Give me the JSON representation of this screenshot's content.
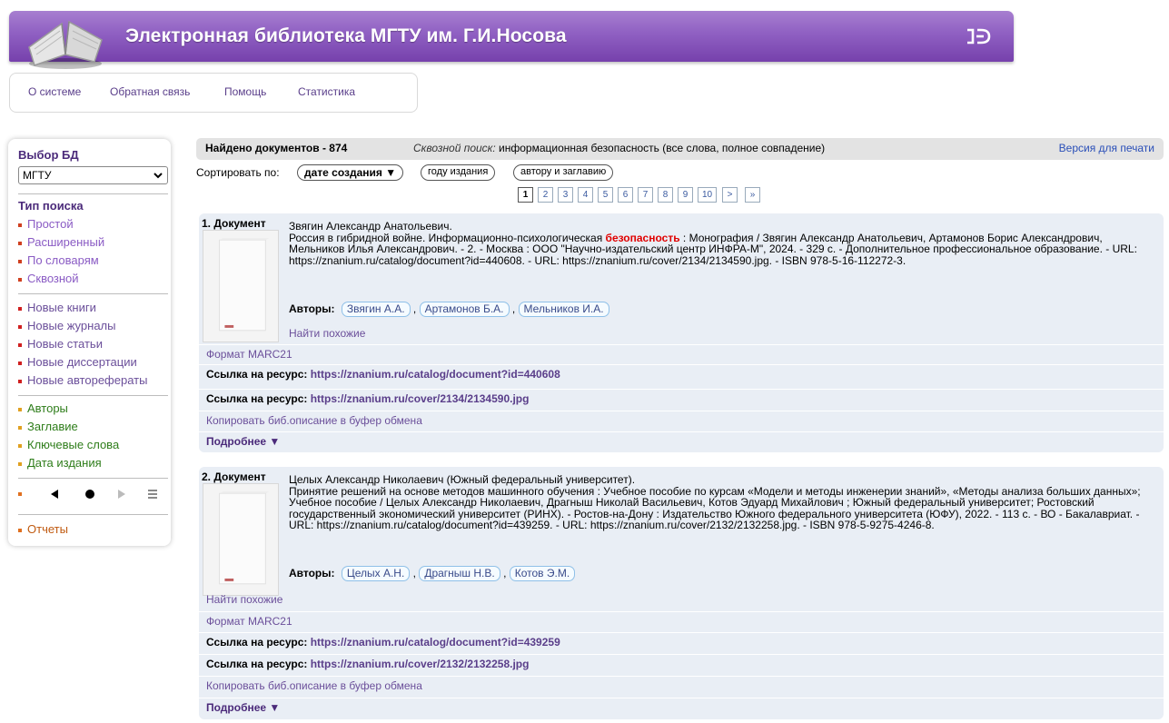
{
  "header": {
    "title": "Электронная библиотека МГТУ им. Г.И.Носова",
    "logo_icon": "open-book-icon",
    "corner_icon": "ib-logo-icon"
  },
  "topnav": {
    "items": [
      "О системе",
      "Обратная связь",
      "Помощь",
      "Статистика"
    ]
  },
  "sidebar": {
    "db_label": "Выбор БД",
    "db_value": "МГТУ",
    "search_type_label": "Тип поиска",
    "search_types": [
      "Простой",
      "Расширенный",
      "По словарям",
      "Сквозной"
    ],
    "news": [
      "Новые книги",
      "Новые журналы",
      "Новые статьи",
      "Новые диссертации",
      "Новые авторефераты"
    ],
    "browse": [
      "Авторы",
      "Заглавие",
      "Ключевые слова",
      "Дата издания"
    ],
    "reports": "Отчеты",
    "colors": {
      "search_bullet": "#8a5bc4",
      "news_bullet": "#d02020",
      "browse_bullet": "#5aa02c",
      "reports_bullet": "#e07020"
    }
  },
  "results": {
    "found": "Найдено документов - 874",
    "through_label": "Сквозной поиск:",
    "through_query": "информационная безопасность (все слова, полное совпадение)",
    "print_version": "Версия для печати",
    "sort_label": "Сортировать по:",
    "sort_options": [
      "дате создания ▼",
      "году издания",
      "автору и заглавию"
    ],
    "pages": [
      "1",
      "2",
      "3",
      "4",
      "5",
      "6",
      "7",
      "8",
      "9",
      "10",
      ">",
      "»"
    ],
    "current_page": "1"
  },
  "documents": [
    {
      "num": "1. Документ",
      "author_line": "Звягин Александр Анатольевич.",
      "desc_before": "Россия в гибридной войне. Информационно-психологическая ",
      "highlight": "безопасность",
      "desc_after": " : Монография / Звягин Александр Анатольевич, Артамонов Борис Александрович, Мельников Илья Александрович. - 2. - Москва : ООО \"Научно-издательский центр ИНФРА-М\", 2024. - 329 с. - Дополнительное профессиональное образование. - URL: https://znanium.ru/catalog/document?id=440608. - URL: https://znanium.ru/cover/2134/2134590.jpg. - ISBN 978-5-16-112272-3.",
      "authors_label": "Авторы:",
      "authors": [
        "Звягин А.А.",
        "Артамонов Б.А.",
        "Мельников И.А."
      ],
      "similar": "Найти похожие",
      "marc": "Формат MARC21",
      "resource_label": "Ссылка на ресурс:",
      "resource_urls": [
        "https://znanium.ru/catalog/document?id=440608",
        "https://znanium.ru/cover/2134/2134590.jpg"
      ],
      "copy": "Копировать биб.описание в буфер обмена",
      "more": "Подробнее ▼"
    },
    {
      "num": "2. Документ",
      "author_line": "Целых Александр Николаевич (Южный федеральный университет).",
      "desc_before": "Принятие решений на основе методов машинного обучения : Учебное пособие по курсам «Модели и методы инженерии знаний», «Методы анализа больших данных»; Учебное пособие / Целых Александр Николаевич, Драгныш Николай Васильевич, Котов Эдуард Михайлович ; Южный федеральный университет; Ростовский государственный экономический университет (РИНХ). - Ростов-на-Дону : Издательство Южного федерального университета (ЮФУ), 2022. - 113 с. - ВО - Бакалавриат. - URL: https://znanium.ru/catalog/document?id=439259. - URL: https://znanium.ru/cover/2132/2132258.jpg. - ISBN 978-5-9275-4246-8.",
      "highlight": "",
      "desc_after": "",
      "authors_label": "Авторы:",
      "authors": [
        "Целых А.Н.",
        "Драгныш Н.В.",
        "Котов Э.М."
      ],
      "similar": "Найти похожие",
      "marc": "Формат MARC21",
      "resource_label": "Ссылка на ресурс:",
      "resource_urls": [
        "https://znanium.ru/catalog/document?id=439259",
        "https://znanium.ru/cover/2132/2132258.jpg"
      ],
      "copy": "Копировать биб.описание в буфер обмена",
      "more": "Подробнее ▼"
    }
  ]
}
